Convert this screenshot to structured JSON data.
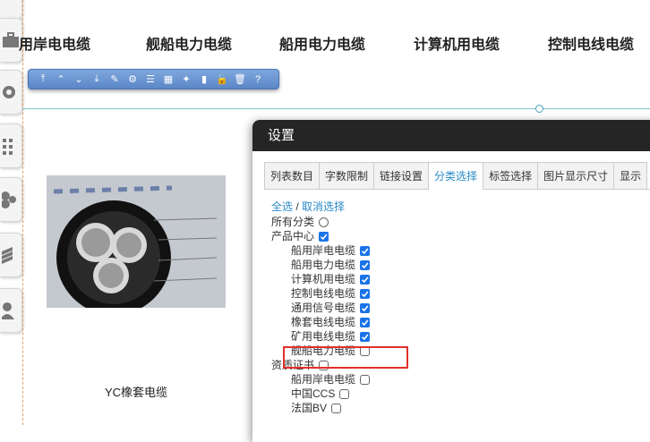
{
  "nav": {
    "items": [
      "用岸电电缆",
      "舰船电力电缆",
      "船用电力电缆",
      "计算机用电缆",
      "控制电线电缆"
    ]
  },
  "toolbar": {
    "buttons": [
      "move-top-icon",
      "move-up-icon",
      "move-down-icon",
      "move-bottom-icon",
      "edit-icon",
      "settings-icon",
      "list-icon",
      "grid-icon",
      "magic-icon",
      "chart-icon",
      "unlock-icon",
      "delete-icon",
      "help-icon"
    ]
  },
  "product": {
    "name": "YC橡套电缆"
  },
  "dialog": {
    "title": "设置",
    "tabs": [
      "列表数目",
      "字数限制",
      "链接设置",
      "分类选择",
      "标签选择",
      "图片显示尺寸",
      "显示"
    ],
    "active_tab": "分类选择",
    "select_all": "全选",
    "separator": " / ",
    "deselect": "取消选择",
    "tree": [
      {
        "label": "所有分类",
        "type": "radio",
        "checked": false,
        "level": 0
      },
      {
        "label": "产品中心",
        "type": "checkbox",
        "checked": true,
        "level": 0
      },
      {
        "label": "船用岸电电缆",
        "type": "checkbox",
        "checked": true,
        "level": 1
      },
      {
        "label": "船用电力电缆",
        "type": "checkbox",
        "checked": true,
        "level": 1
      },
      {
        "label": "计算机用电缆",
        "type": "checkbox",
        "checked": true,
        "level": 1
      },
      {
        "label": "控制电线电缆",
        "type": "checkbox",
        "checked": true,
        "level": 1
      },
      {
        "label": "通用信号电缆",
        "type": "checkbox",
        "checked": true,
        "level": 1
      },
      {
        "label": "橡套电线电缆",
        "type": "checkbox",
        "checked": true,
        "level": 1
      },
      {
        "label": "矿用电线电缆",
        "type": "checkbox",
        "checked": true,
        "level": 1
      },
      {
        "label": "舰船电力电缆",
        "type": "checkbox",
        "checked": false,
        "level": 1
      },
      {
        "label": "资质证书",
        "type": "checkbox",
        "checked": false,
        "level": 0
      },
      {
        "label": "船用岸电电缆",
        "type": "checkbox",
        "checked": false,
        "level": 1
      },
      {
        "label": "中国CCS",
        "type": "checkbox",
        "checked": false,
        "level": 1
      },
      {
        "label": "法国BV",
        "type": "checkbox",
        "checked": false,
        "level": 1
      }
    ]
  },
  "colors": {
    "accent": "#2a8ac8",
    "checkbox": "#1a73e8",
    "highlight": "#e0302a",
    "header": "#252525"
  }
}
